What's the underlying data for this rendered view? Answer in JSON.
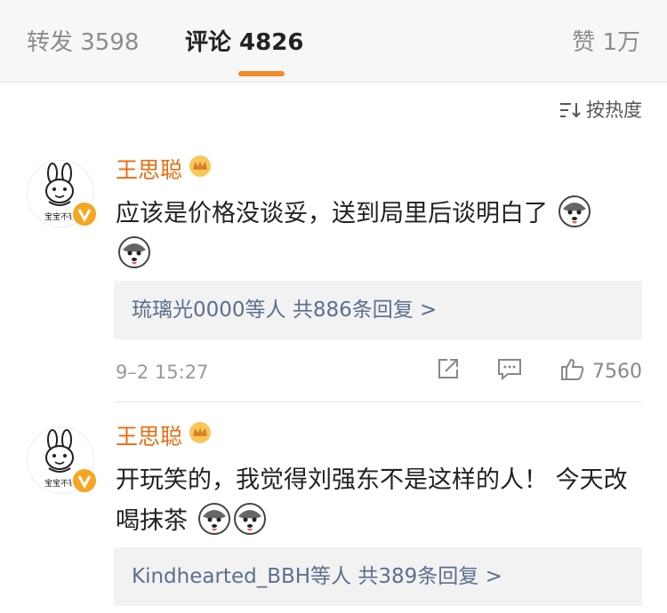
{
  "tabs": {
    "repost": "转发 3598",
    "comments": "评论 4826",
    "likes": "赞 1万"
  },
  "sort": {
    "label": "按热度",
    "icon": "sort-icon"
  },
  "comments": [
    {
      "user": "王思聪",
      "avatar_caption": "宝宝不铂",
      "text": "应该是价格没谈妥，送到局里后谈明白了",
      "emoji_count": 2,
      "replies": "琉璃光0000等人  共886条回复 >",
      "time": "9–2 15:27",
      "likes": "7560"
    },
    {
      "user": "王思聪",
      "avatar_caption": "宝宝不铂",
      "text": "开玩笑的，我觉得刘强东不是这样的人！ 今天改喝抹茶",
      "emoji_count": 2,
      "replies": "Kindhearted_BBH等人  共389条回复 >"
    }
  ],
  "colors": {
    "accent": "#f28a2a",
    "username": "#e86c10",
    "link": "#5c6f8c"
  }
}
